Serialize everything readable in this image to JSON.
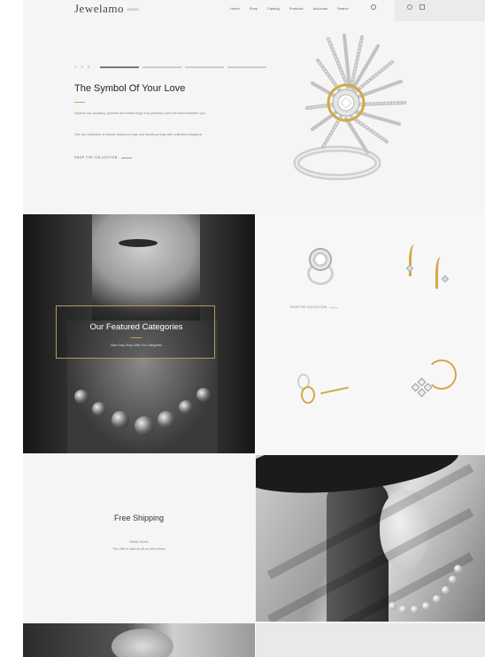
{
  "header": {
    "logo": "Jewelamo",
    "logo_sub": "RINGS",
    "nav": [
      "Home",
      "Shop",
      "Catalog",
      "Products",
      "Accounts"
    ],
    "search_label": "Search"
  },
  "hero": {
    "slide_counter": "1 2 3",
    "title": "The Symbol Of Your Love",
    "paragraph1": "Explore our wedding, promise and bridal rings that perfectly mark the bond between you.",
    "paragraph2": "See our collection of classic diamond rings and wedding rings with unlimited elegance.",
    "cta": "SHOP THE COLLECTION"
  },
  "featured": {
    "title": "Our Featured Categories",
    "subtitle": "Start Easy Shop With Our Categories"
  },
  "products": {
    "label": "SHOP THE COLLECTION"
  },
  "shipping": {
    "title": "Free Shipping",
    "line1": "Nearly Stores",
    "line2": "This offer is valid on all our store items"
  },
  "colors": {
    "accent": "#c9a74a",
    "background": "#f5f5f5",
    "text": "#222222"
  }
}
